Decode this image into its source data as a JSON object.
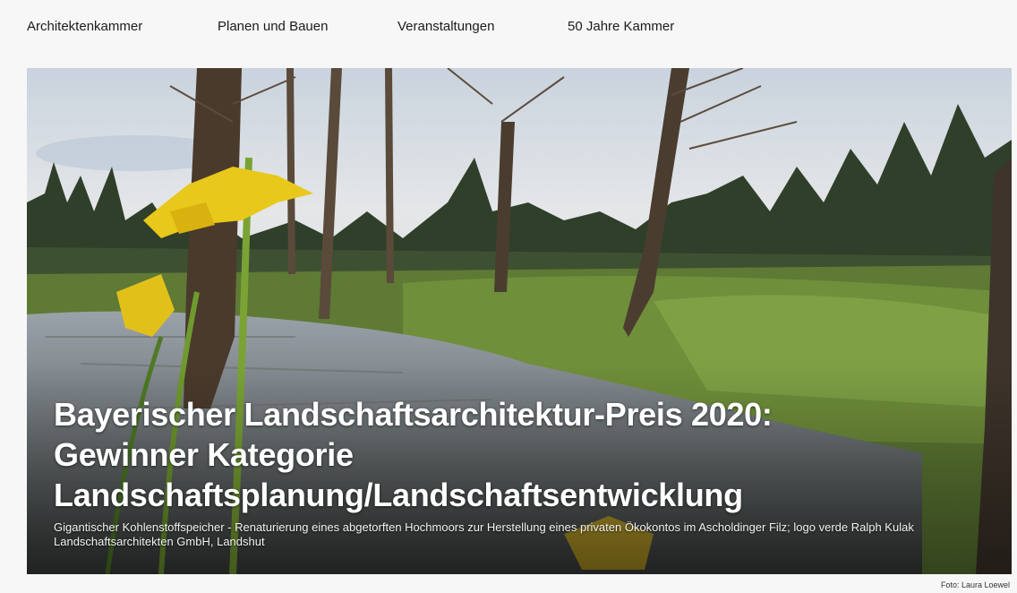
{
  "nav": {
    "items": [
      {
        "label": "Architektenkammer"
      },
      {
        "label": "Planen und Bauen"
      },
      {
        "label": "Veranstaltungen"
      },
      {
        "label": "50 Jahre Kammer"
      }
    ]
  },
  "hero": {
    "title_lines": [
      "Bayerischer Landschaftsarchitektur-Preis 2020:",
      "Gewinner Kategorie",
      "Landschaftsplanung/Landschaftsentwicklung"
    ],
    "caption": "Gigantischer Kohlenstoffspeicher - Renaturierung eines abgetorften Hochmoors zur Herstellung eines privaten Ökokontos im Ascholdinger Filz; logo verde Ralph Kulak Landschaftsarchitekten GmbH, Landshut",
    "image_subject": "moor-landscape-photo",
    "colors": {
      "title": "#ffffff",
      "sky": "#d9dde2",
      "grass": "#6f8f3a",
      "water": "#8a8f96",
      "flower": "#e8c81a"
    }
  },
  "credit": "Foto: Laura Loewel"
}
